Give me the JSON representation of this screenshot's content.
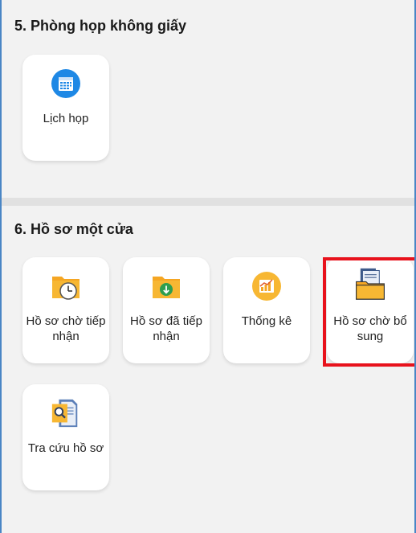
{
  "sections": [
    {
      "title": "5. Phòng họp không giấy",
      "tiles": [
        {
          "label": "Lịch họp",
          "icon": "calendar-icon"
        }
      ]
    },
    {
      "title": "6. Hồ sơ một cửa",
      "tiles": [
        {
          "label": "Hồ sơ chờ tiếp nhận",
          "icon": "folder-clock-icon"
        },
        {
          "label": "Hồ sơ đã tiếp nhận",
          "icon": "folder-download-icon"
        },
        {
          "label": "Thống kê",
          "icon": "chart-icon"
        },
        {
          "label": "Hồ sơ chờ bổ sung",
          "icon": "folder-documents-icon"
        },
        {
          "label": "Tra cứu hồ sơ",
          "icon": "document-search-icon"
        }
      ]
    }
  ],
  "colors": {
    "accent_blue": "#1e88e5",
    "folder_orange": "#f5a623",
    "highlight_red": "#e8121c"
  }
}
